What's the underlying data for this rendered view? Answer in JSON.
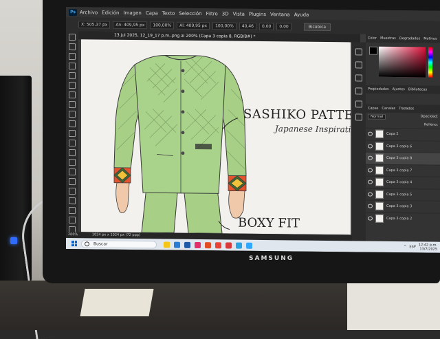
{
  "photo": {
    "monitor_brand": "SAMSUNG"
  },
  "photoshop": {
    "app_icon": "Ps",
    "menu": [
      "Archivo",
      "Edición",
      "Imagen",
      "Capa",
      "Texto",
      "Selección",
      "Filtro",
      "3D",
      "Vista",
      "Plugins",
      "Ventana",
      "Ayuda"
    ],
    "options": {
      "x": "X: 505,37 px",
      "w": "An: 409,95 px",
      "scale_w": "100,00%",
      "h": "Al: 409,95 px",
      "scale_h": "100,00%",
      "angle": "40,46",
      "h_skew": "0,00",
      "v_skew": "0,00",
      "interp": "Bicúbica"
    },
    "document_tab": "13 jul 2025, 12_19_17 p.m..png al 200% (Capa 3 copia 8, RGB/8#) *",
    "canvas_text": {
      "heading1": "SASHIKO PATTERN",
      "sub1": "Japanese Inspirati",
      "heading2": "BOXY FIT"
    },
    "status": {
      "zoom": "200%",
      "doc_info": "1024 px x 1024 px (72 ppp)"
    },
    "color_panel": {
      "tabs": [
        "Color",
        "Muestras",
        "Degradados",
        "Motivos"
      ],
      "accent": "#e0123c"
    },
    "layers_panel": {
      "props_tabs": [
        "Propiedades",
        "Ajustes",
        "Bibliotecas"
      ],
      "tabs": [
        "Capas",
        "Canales",
        "Trazados"
      ],
      "blend_mode": "Normal",
      "opacity_label": "Opacidad:",
      "fill_label": "Relleno:",
      "layers": [
        "Capa 2",
        "Capa 3 copia 6",
        "Capa 3 copia 8",
        "Capa 3 copia 7",
        "Capa 3 copia 4",
        "Capa 3 copia 5",
        "Capa 3 copia 3",
        "Capa 3 copia 2"
      ],
      "active_index": 2
    }
  },
  "taskbar": {
    "search_placeholder": "Buscar",
    "app_colors": [
      "#f5c518",
      "#2b7cd3",
      "#1e5aa8",
      "#e1306c",
      "#e34d26",
      "#ea4335",
      "#d83b3b",
      "#2aa3e2",
      "#31a8ff"
    ],
    "language": "ESP",
    "time": "12:42 p.m.",
    "date": "13/7/2025"
  }
}
